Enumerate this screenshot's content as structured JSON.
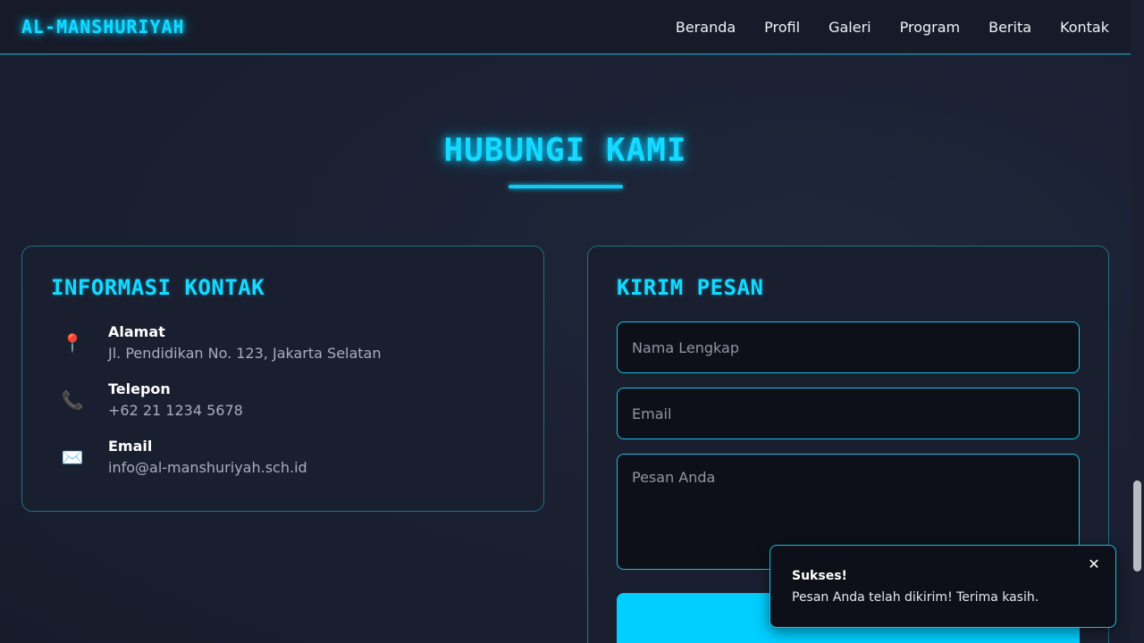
{
  "navbar": {
    "brand": "AL-MANSHURIYAH",
    "links": [
      "Beranda",
      "Profil",
      "Galeri",
      "Program",
      "Berita",
      "Kontak"
    ]
  },
  "section": {
    "title": "HUBUNGI KAMI"
  },
  "contact_info": {
    "heading": "INFORMASI KONTAK",
    "items": [
      {
        "icon": "map-pin-icon",
        "glyph": "📍",
        "label": "Alamat",
        "value": "Jl. Pendidikan No. 123, Jakarta Selatan"
      },
      {
        "icon": "phone-icon",
        "glyph": "📞",
        "label": "Telepon",
        "value": "+62 21 1234 5678"
      },
      {
        "icon": "envelope-icon",
        "glyph": "✉️",
        "label": "Email",
        "value": "info@al-manshuriyah.sch.id"
      }
    ]
  },
  "form": {
    "heading": "KIRIM PESAN",
    "name_placeholder": "Nama Lengkap",
    "email_placeholder": "Email",
    "message_placeholder": "Pesan Anda",
    "submit_label": ""
  },
  "toast": {
    "title": "Sukses!",
    "message": "Pesan Anda telah dikirim! Terima kasih.",
    "close_glyph": "✕"
  },
  "colors": {
    "accent": "#00cfff",
    "background": "#1b2133",
    "card": "#1a1f30"
  }
}
